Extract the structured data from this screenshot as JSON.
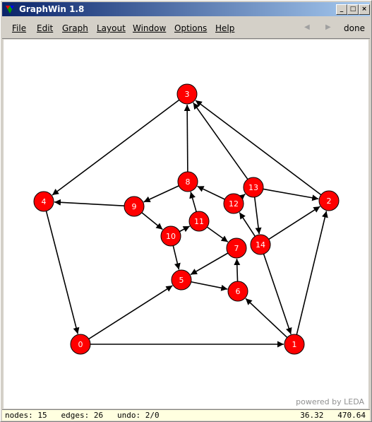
{
  "window": {
    "title": "GraphWin 1.8"
  },
  "menu": {
    "items": [
      {
        "label": "File"
      },
      {
        "label": "Edit"
      },
      {
        "label": "Graph"
      },
      {
        "label": "Layout"
      },
      {
        "label": "Window"
      },
      {
        "label": "Options"
      },
      {
        "label": "Help"
      }
    ],
    "done_label": "done",
    "back_icon": "left-arrow-icon",
    "forward_icon": "right-arrow-icon"
  },
  "canvas": {
    "powered_by": "powered by LEDA"
  },
  "graph": {
    "node_color": "#ff0000",
    "node_text_color": "#ffffff",
    "nodes": [
      {
        "id": "0",
        "label": "0"
      },
      {
        "id": "1",
        "label": "1"
      },
      {
        "id": "2",
        "label": "2"
      },
      {
        "id": "3",
        "label": "3"
      },
      {
        "id": "4",
        "label": "4"
      },
      {
        "id": "5",
        "label": "5"
      },
      {
        "id": "6",
        "label": "6"
      },
      {
        "id": "7",
        "label": "7"
      },
      {
        "id": "8",
        "label": "8"
      },
      {
        "id": "9",
        "label": "9"
      },
      {
        "id": "10",
        "label": "10"
      },
      {
        "id": "11",
        "label": "11"
      },
      {
        "id": "12",
        "label": "12"
      },
      {
        "id": "13",
        "label": "13"
      },
      {
        "id": "14",
        "label": "14"
      }
    ],
    "edges": [
      [
        "3",
        "4"
      ],
      [
        "4",
        "0"
      ],
      [
        "0",
        "1"
      ],
      [
        "1",
        "2"
      ],
      [
        "2",
        "3"
      ],
      [
        "9",
        "4"
      ],
      [
        "0",
        "5"
      ],
      [
        "14",
        "1"
      ],
      [
        "1",
        "6"
      ],
      [
        "14",
        "2"
      ],
      [
        "13",
        "2"
      ],
      [
        "13",
        "3"
      ],
      [
        "8",
        "3"
      ],
      [
        "8",
        "9"
      ],
      [
        "9",
        "10"
      ],
      [
        "10",
        "11"
      ],
      [
        "11",
        "8"
      ],
      [
        "11",
        "7"
      ],
      [
        "10",
        "5"
      ],
      [
        "5",
        "6"
      ],
      [
        "6",
        "7"
      ],
      [
        "7",
        "5"
      ],
      [
        "12",
        "8"
      ],
      [
        "12",
        "13"
      ],
      [
        "13",
        "14"
      ],
      [
        "14",
        "12"
      ]
    ]
  },
  "status": {
    "nodes": "nodes: 15",
    "edges": "edges: 26",
    "undo": "undo: 2/0",
    "coords": "36.32   470.64"
  }
}
